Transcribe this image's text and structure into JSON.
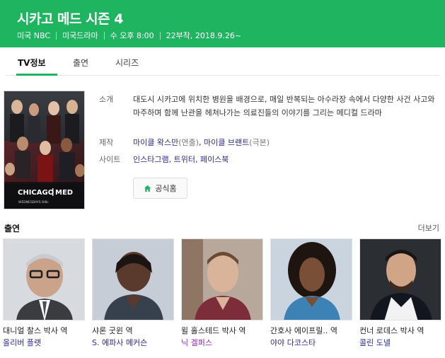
{
  "header": {
    "title": "시카고 메드 시즌 4",
    "meta": [
      "미국 NBC",
      "미국드라마",
      "수 오후 8:00",
      "22부작, 2018.9.26~"
    ],
    "bg_color": "#1fb45f"
  },
  "tabs": [
    {
      "label": "TV정보",
      "active": true
    },
    {
      "label": "출연",
      "active": false
    },
    {
      "label": "시리즈",
      "active": false
    }
  ],
  "poster": {
    "logo_text_left": "CHICAGO",
    "logo_text_right": "MED",
    "tagline": "WEDNESDAYS 9/8c"
  },
  "info": {
    "summary_label": "소개",
    "summary": "대도시 시카고에 위치한 병원을 배경으로, 매일 반복되는 아수라장 속에서 다양한 사건 사고와 마주하며 함께 난관을 헤쳐나가는 의료진들의 이야기를 그리는 메디컬 드라마",
    "production_label": "제작",
    "producer1": "마이클 왁스만",
    "producer1_role": "(연출)",
    "producer_sep": ", ",
    "producer2": "마이클 브랜트",
    "producer2_role": "(극본)",
    "site_label": "사이트",
    "sites": "인스타그램, 트위터, 페이스북",
    "home_button": "공식홈"
  },
  "cast": {
    "title": "출연",
    "more": "더보기",
    "items": [
      {
        "role": "대니얼 찰스 박사 역",
        "actor": "올리버 플랫",
        "actor_color": "#2c2c8c"
      },
      {
        "role": "샤론 굿윈 역",
        "actor": "S. 에파사 메커슨",
        "actor_color": "#2c2c8c"
      },
      {
        "role": "윌 홀스테드 박사 역",
        "actor": "닉 겔퍼스",
        "actor_color": "#8a2cb0"
      },
      {
        "role": "간호사 에이프릴.. 역",
        "actor": "야야 다코스타",
        "actor_color": "#2c2c8c"
      },
      {
        "role": "컨너 로데스 박사 역",
        "actor": "콜린 도넬",
        "actor_color": "#2c2c8c"
      }
    ]
  }
}
